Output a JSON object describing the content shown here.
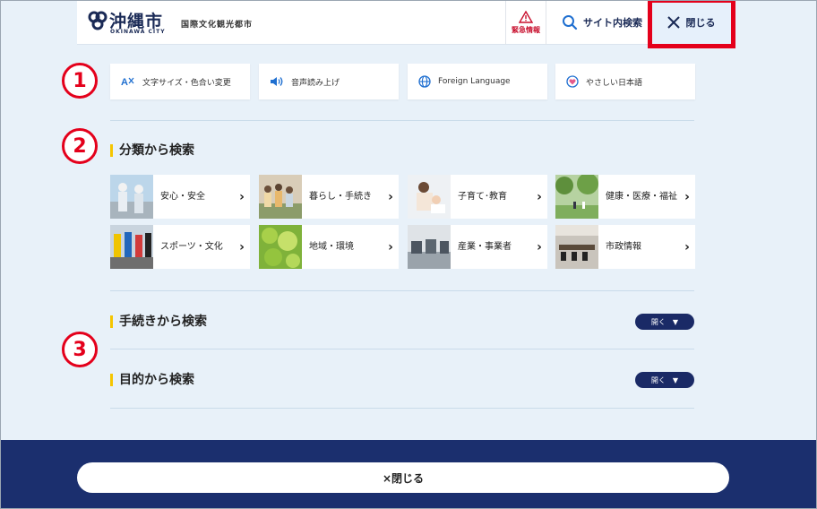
{
  "header": {
    "logo_name": "沖縄市",
    "logo_sub": "OKINAWA CITY",
    "tagline": "国際文化観光都市",
    "emergency_label": "緊急情報",
    "search_label": "サイト内検索",
    "close_label": "閉じる"
  },
  "markers": [
    "1",
    "2",
    "3"
  ],
  "utilities": [
    {
      "label": "文字サイズ・色合い変更",
      "icon": "text-size-icon"
    },
    {
      "label": "音声読み上げ",
      "icon": "speaker-icon"
    },
    {
      "label": "Foreign Language",
      "icon": "globe-icon"
    },
    {
      "label": "やさしい日本語",
      "icon": "heart-icon"
    }
  ],
  "sections": {
    "category_title": "分類から検索",
    "procedure_title": "手続きから検索",
    "purpose_title": "目的から検索",
    "open_label": "開く"
  },
  "categories": [
    {
      "label": "安心・安全"
    },
    {
      "label": "暮らし・手続き"
    },
    {
      "label": "子育て･教育"
    },
    {
      "label": "健康・医療・福祉"
    },
    {
      "label": "スポーツ・文化"
    },
    {
      "label": "地域・環境"
    },
    {
      "label": "産業・事業者"
    },
    {
      "label": "市政情報"
    }
  ],
  "footer": {
    "close_label": "×閉じる"
  },
  "colors": {
    "navy": "#1b2f6e",
    "accent_red": "#e4001b",
    "heading_bar": "#f5c500",
    "background": "#e8f1f9"
  }
}
